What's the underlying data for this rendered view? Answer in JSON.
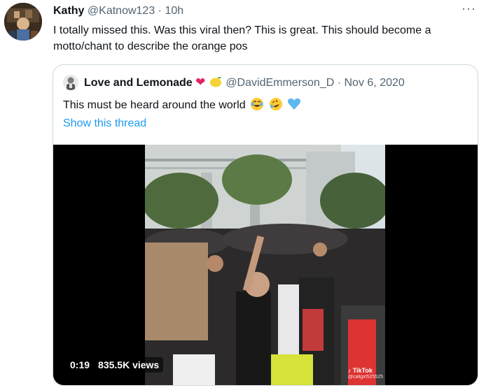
{
  "tweet": {
    "author_name": "Kathy",
    "author_handle": "@Katnow123",
    "separator": "·",
    "time": "10h",
    "more_label": "···",
    "text": "I totally missed this. Was this viral then? This is great. This should become a motto/chant to describe the orange pos"
  },
  "quoted_tweet": {
    "author_name": "Love and Lemonade",
    "author_handle": "@DavidEmmerson_D",
    "separator": "·",
    "date": "Nov 6, 2020",
    "text": "This must be heard around the world",
    "show_thread_label": "Show this thread",
    "emoji_icons": [
      "laughing-tears-icon",
      "rolling-laughing-icon",
      "blue-heart-icon"
    ],
    "name_emoji_icons": [
      "red-heart-icon",
      "lemon-icon"
    ]
  },
  "video": {
    "duration": "0:19",
    "views": "835.5K views",
    "watermark_brand": "TikTok",
    "watermark_user": "@callgirl525525"
  },
  "colors": {
    "link": "#1d9bf0",
    "secondary_text": "#536471",
    "border": "#cfd9de",
    "heart": "#e0245e"
  }
}
